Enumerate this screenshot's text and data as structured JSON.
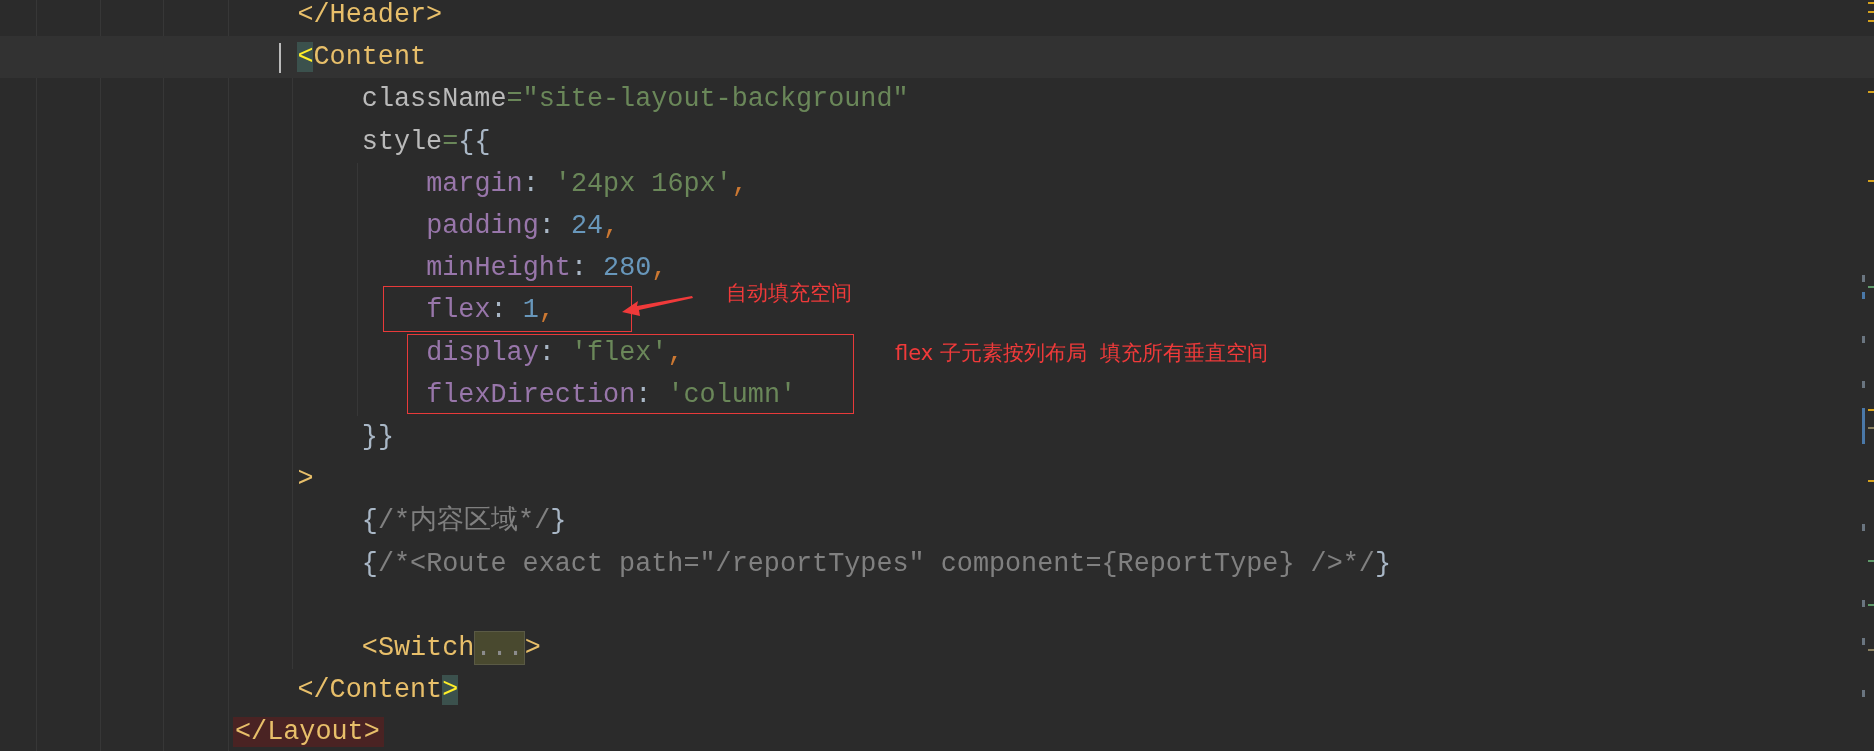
{
  "editor": {
    "lines": [
      {
        "children": [
          {
            "tokens": [
              {
                "kind": "tag",
                "text": "</Header>"
              }
            ]
          },
          {
            "current": true,
            "tokens": [
              {
                "kind": "match",
                "text": "<"
              },
              {
                "kind": "tag",
                "text": "Content"
              }
            ],
            "children": [
              {
                "tokens": [
                  {
                    "kind": "attr",
                    "text": "className"
                  },
                  {
                    "kind": "string",
                    "text": "=\"site-layout-background\""
                  }
                ]
              },
              {
                "tokens": [
                  {
                    "kind": "attr",
                    "text": "style"
                  },
                  {
                    "kind": "string",
                    "text": "="
                  },
                  {
                    "kind": "brace",
                    "text": "{{"
                  }
                ],
                "children": [
                  {
                    "tokens": [
                      {
                        "kind": "prop",
                        "text": "margin"
                      },
                      {
                        "kind": "plain",
                        "text": ": "
                      },
                      {
                        "kind": "string",
                        "text": "'24px 16px'"
                      },
                      {
                        "kind": "comma",
                        "text": ","
                      }
                    ]
                  },
                  {
                    "tokens": [
                      {
                        "kind": "prop",
                        "text": "padding"
                      },
                      {
                        "kind": "plain",
                        "text": ": "
                      },
                      {
                        "kind": "number",
                        "text": "24"
                      },
                      {
                        "kind": "comma",
                        "text": ","
                      }
                    ]
                  },
                  {
                    "tokens": [
                      {
                        "kind": "prop",
                        "text": "minHeight"
                      },
                      {
                        "kind": "plain",
                        "text": ": "
                      },
                      {
                        "kind": "number",
                        "text": "280"
                      },
                      {
                        "kind": "comma",
                        "text": ","
                      }
                    ]
                  },
                  {
                    "tokens": [
                      {
                        "kind": "prop",
                        "text": "flex"
                      },
                      {
                        "kind": "plain",
                        "text": ": "
                      },
                      {
                        "kind": "number",
                        "text": "1"
                      },
                      {
                        "kind": "comma",
                        "text": ","
                      }
                    ]
                  },
                  {
                    "tokens": [
                      {
                        "kind": "prop",
                        "text": "display"
                      },
                      {
                        "kind": "plain",
                        "text": ": "
                      },
                      {
                        "kind": "string",
                        "text": "'flex'"
                      },
                      {
                        "kind": "comma",
                        "text": ","
                      }
                    ]
                  },
                  {
                    "tokens": [
                      {
                        "kind": "prop",
                        "text": "flexDirection"
                      },
                      {
                        "kind": "plain",
                        "text": ": "
                      },
                      {
                        "kind": "string",
                        "text": "'column'"
                      }
                    ]
                  }
                ]
              },
              {
                "tokens": [
                  {
                    "kind": "brace",
                    "text": "}}"
                  }
                ]
              }
            ]
          },
          {
            "tokens": [
              {
                "kind": "tag",
                "text": ">"
              }
            ],
            "children": [
              {
                "kind": "code",
                "tokens": [
                  {
                    "kind": "brace",
                    "text": "{"
                  },
                  {
                    "kind": "comment",
                    "text": "/*内容区域*/"
                  },
                  {
                    "kind": "brace",
                    "text": "}"
                  }
                ]
              },
              {
                "kind": "code",
                "tokens": [
                  {
                    "kind": "brace",
                    "text": "{"
                  },
                  {
                    "kind": "comment",
                    "text": "/*<Route exact path=\"/reportTypes\" component={ReportType} />*/"
                  },
                  {
                    "kind": "brace",
                    "text": "}"
                  }
                ]
              },
              {
                "kind": "blank"
              },
              {
                "kind": "code",
                "tokens": [
                  {
                    "kind": "tag",
                    "text": "<Switch"
                  },
                  {
                    "kind": "fold",
                    "text": "..."
                  },
                  {
                    "kind": "tag",
                    "text": ">"
                  }
                ]
              }
            ]
          },
          {
            "tokens": [
              {
                "kind": "tag",
                "text": "</Content"
              },
              {
                "kind": "match",
                "text": ">"
              }
            ]
          }
        ]
      },
      {
        "tokens": [
          {
            "kind": "unmatched",
            "text": "</Layout>"
          }
        ]
      }
    ]
  },
  "annotations": [
    {
      "text": "自动填充空间"
    },
    {
      "text": "flex 子元素按列布局  填充所有垂直空间"
    }
  ]
}
